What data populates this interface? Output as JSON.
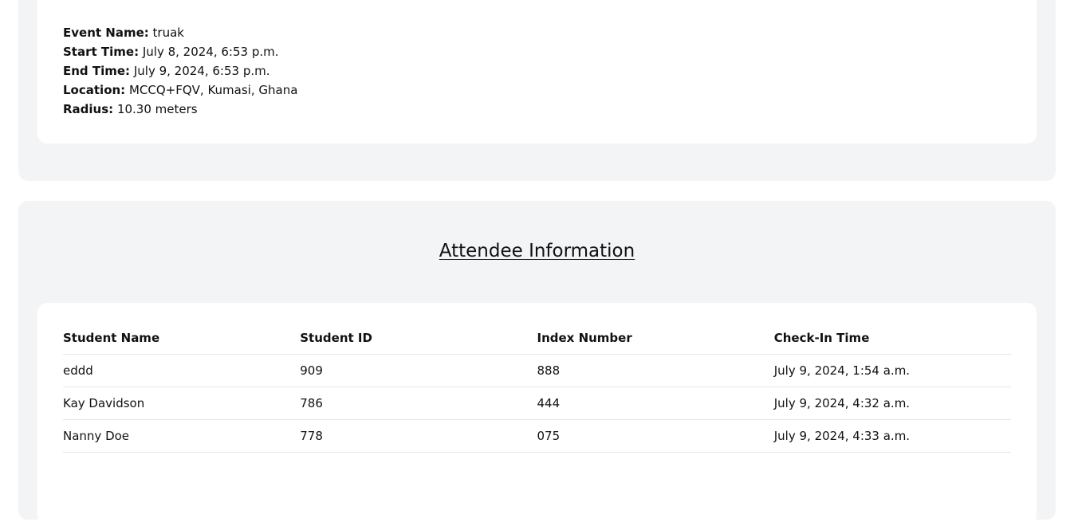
{
  "event": {
    "name_label": "Event Name:",
    "name_value": "truak",
    "start_label": "Start Time:",
    "start_value": "July 8, 2024, 6:53 p.m.",
    "end_label": "End Time:",
    "end_value": "July 9, 2024, 6:53 p.m.",
    "location_label": "Location:",
    "location_value": "MCCQ+FQV, Kumasi, Ghana",
    "radius_label": "Radius:",
    "radius_value": "10.30 meters"
  },
  "attendees": {
    "title": "Attendee Information",
    "columns": [
      "Student Name",
      "Student ID",
      "Index Number",
      "Check-In Time"
    ],
    "rows": [
      [
        "eddd",
        "909",
        "888",
        "July 9, 2024, 1:54 a.m."
      ],
      [
        "Kay Davidson",
        "786",
        "444",
        "July 9, 2024, 4:32 a.m."
      ],
      [
        "Nanny Doe",
        "778",
        "075",
        "July 9, 2024, 4:33 a.m."
      ]
    ]
  }
}
